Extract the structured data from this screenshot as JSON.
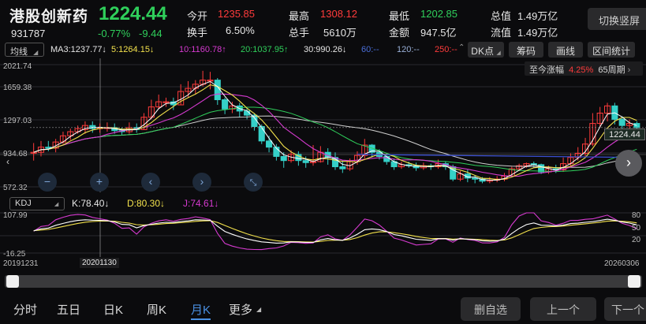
{
  "header": {
    "name": "港股创新药",
    "code": "931787",
    "price": "1224.44",
    "change_pct": "-0.77%",
    "change": "-9.44",
    "quotes": [
      {
        "label": "今开",
        "value": "1235.85",
        "color": "red"
      },
      {
        "label": "最高",
        "value": "1308.12",
        "color": "red"
      },
      {
        "label": "最低",
        "value": "1202.85",
        "color": "green"
      },
      {
        "label": "总值",
        "value": "1.49万亿",
        "color": "plain"
      },
      {
        "label": "换手",
        "value": "6.50%",
        "color": "plain"
      },
      {
        "label": "总手",
        "value": "5610万",
        "color": "plain"
      },
      {
        "label": "金额",
        "value": "947.5亿",
        "color": "plain"
      },
      {
        "label": "流值",
        "value": "1.49万亿",
        "color": "plain"
      }
    ],
    "switch_label": "切换竖屏"
  },
  "indicators": {
    "ma_select": "均线",
    "ma3": "MA3:1237.77↓",
    "ma5": "5:1264.15↓",
    "ma10": "10:1160.78↑",
    "ma20": "20:1037.95↑",
    "ma30": "30:990.26↓",
    "ma60": "60:--",
    "ma120": "120:--",
    "ma250": "250:--",
    "dk_label": "DK点",
    "chip_label": "筹码",
    "draw_label": "画线",
    "range_label": "区间统计"
  },
  "period": {
    "prefix": "至今涨幅",
    "pct": "4.25%",
    "weeks": "65周期"
  },
  "y_axis": {
    "top": "2021.74",
    "mid1": "1659.38",
    "mid2": "1297.03",
    "mid3": "934.68",
    "bottom": "572.32"
  },
  "current_price_tag": "1224.44",
  "kdj": {
    "select": "KDJ",
    "k": "K:78.40↓",
    "d": "D:80.30↓",
    "j": "J:74.61↓",
    "y_top": "107.99",
    "y_bottom": "-16.25",
    "right_80": "80",
    "right_50": "50",
    "right_20": "20"
  },
  "dates": {
    "start": "20191231",
    "cursor": "20201130",
    "end": "20260306"
  },
  "tabs": [
    "分时",
    "五日",
    "日K",
    "周K",
    "月K",
    "更多"
  ],
  "active_tab": "月K",
  "bottom_buttons": {
    "remove": "删自选",
    "prev": "上一个",
    "next": "下一个"
  },
  "icons": {
    "minus": "minus-icon",
    "plus": "plus-icon",
    "left": "chevron-left-icon",
    "right": "chevron-right-icon",
    "collapse": "collapse-icon"
  },
  "colors": {
    "up": "#ff3b3b",
    "down": "#2fcf5b",
    "ma3": "#ffffff",
    "ma5": "#f2e14c",
    "ma10": "#d63ad0",
    "ma20": "#2fcf5b",
    "accent": "#4a90e2"
  },
  "candles": [
    [
      2.0,
      2.0,
      2.9,
      1.2
    ],
    [
      2.0,
      2.5,
      3.1,
      1.6
    ],
    [
      2.5,
      2.4,
      3.1,
      2.1
    ],
    [
      2.4,
      3.0,
      3.3,
      2.0
    ],
    [
      3.0,
      3.6,
      4.0,
      2.8
    ],
    [
      3.6,
      4.0,
      4.3,
      3.2
    ],
    [
      4.0,
      4.3,
      4.6,
      3.8
    ],
    [
      4.2,
      4.6,
      5.0,
      3.8
    ],
    [
      4.6,
      4.3,
      5.0,
      3.9
    ],
    [
      4.3,
      4.4,
      4.8,
      3.9
    ],
    [
      4.4,
      4.4,
      4.9,
      4.0
    ],
    [
      4.4,
      4.1,
      4.8,
      3.8
    ],
    [
      4.1,
      4.0,
      4.4,
      3.7
    ],
    [
      4.0,
      4.4,
      4.9,
      3.8
    ],
    [
      4.4,
      4.2,
      4.8,
      3.9
    ],
    [
      4.2,
      5.4,
      5.8,
      4.2
    ],
    [
      5.4,
      6.4,
      7.1,
      5.2
    ],
    [
      6.4,
      6.9,
      7.6,
      6.2
    ],
    [
      6.9,
      6.9,
      7.3,
      6.4
    ],
    [
      6.9,
      6.6,
      7.3,
      6.1
    ],
    [
      6.6,
      7.9,
      8.6,
      6.6
    ],
    [
      7.9,
      8.2,
      8.9,
      7.3
    ],
    [
      8.2,
      8.6,
      9.0,
      7.6
    ],
    [
      8.6,
      9.0,
      9.9,
      8.4
    ],
    [
      9.0,
      9.0,
      9.8,
      8.1
    ],
    [
      9.0,
      7.1,
      9.2,
      6.6
    ],
    [
      7.1,
      6.2,
      7.3,
      5.7
    ],
    [
      6.2,
      6.5,
      6.9,
      5.8
    ],
    [
      6.5,
      6.0,
      6.8,
      5.4
    ],
    [
      6.0,
      5.6,
      6.3,
      5.2
    ],
    [
      5.6,
      4.5,
      5.8,
      4.1
    ],
    [
      4.5,
      3.1,
      4.7,
      2.8
    ],
    [
      3.1,
      2.5,
      3.6,
      2.0
    ],
    [
      2.5,
      1.6,
      2.8,
      1.2
    ],
    [
      1.6,
      1.2,
      2.0,
      0.5
    ],
    [
      1.2,
      1.8,
      2.2,
      1.0
    ],
    [
      1.8,
      1.2,
      2.1,
      0.7
    ],
    [
      1.2,
      1.0,
      1.6,
      0.5
    ],
    [
      1.0,
      1.1,
      2.7,
      0.7
    ],
    [
      1.1,
      2.0,
      2.6,
      1.0
    ],
    [
      2.0,
      1.5,
      2.4,
      0.8
    ],
    [
      1.5,
      0.6,
      2.0,
      0.3
    ],
    [
      0.6,
      0.4,
      1.2,
      0.0
    ],
    [
      0.4,
      1.1,
      1.4,
      0.2
    ],
    [
      1.1,
      1.7,
      2.1,
      0.8
    ],
    [
      1.7,
      2.7,
      3.3,
      1.4
    ],
    [
      2.7,
      2.0,
      2.8,
      1.5
    ],
    [
      2.0,
      1.6,
      2.3,
      1.3
    ],
    [
      1.6,
      1.1,
      1.9,
      0.8
    ],
    [
      1.1,
      0.6,
      1.4,
      0.3
    ],
    [
      0.6,
      0.8,
      1.1,
      0.4
    ],
    [
      0.8,
      0.7,
      1.1,
      0.5
    ],
    [
      0.7,
      0.5,
      1.0,
      0.2
    ],
    [
      0.5,
      0.7,
      1.0,
      0.3
    ],
    [
      0.7,
      0.6,
      0.9,
      0.3
    ],
    [
      0.6,
      0.9,
      1.3,
      0.4
    ],
    [
      0.9,
      0.6,
      1.1,
      0.3
    ],
    [
      0.6,
      -0.6,
      0.8,
      -0.8
    ],
    [
      -0.6,
      -0.1,
      0.2,
      -0.8
    ],
    [
      -0.1,
      -0.5,
      0.3,
      -0.9
    ],
    [
      -0.5,
      -0.6,
      -0.2,
      -1.0
    ],
    [
      -0.6,
      -0.8,
      -0.4,
      -1.0
    ],
    [
      -0.8,
      -0.7,
      -0.4,
      -1.0
    ],
    [
      -0.7,
      -0.6,
      -0.3,
      -0.9
    ],
    [
      -0.6,
      -0.3,
      0.0,
      -0.8
    ],
    [
      -0.3,
      0.4,
      0.6,
      -0.4
    ],
    [
      0.4,
      0.7,
      0.9,
      0.2
    ],
    [
      0.7,
      0.9,
      1.0,
      0.5
    ],
    [
      0.9,
      0.8,
      1.1,
      0.5
    ],
    [
      0.8,
      0.1,
      0.9,
      -0.1
    ],
    [
      0.1,
      0.4,
      0.7,
      -0.1
    ],
    [
      0.4,
      0.3,
      0.8,
      0.0
    ],
    [
      0.3,
      0.9,
      1.5,
      0.1
    ],
    [
      0.9,
      1.5,
      1.9,
      0.7
    ],
    [
      1.5,
      1.9,
      2.5,
      1.2
    ],
    [
      1.9,
      2.8,
      3.4,
      1.6
    ],
    [
      2.8,
      4.8,
      5.8,
      2.6
    ],
    [
      4.8,
      5.8,
      6.4,
      4.4
    ],
    [
      5.8,
      6.5,
      6.8,
      5.0
    ],
    [
      6.5,
      5.2,
      6.8,
      4.7
    ],
    [
      5.2,
      4.6,
      5.5,
      4.2
    ],
    [
      4.6,
      4.8,
      5.2,
      4.2
    ],
    [
      4.8,
      4.4,
      5.0,
      4.1
    ]
  ]
}
